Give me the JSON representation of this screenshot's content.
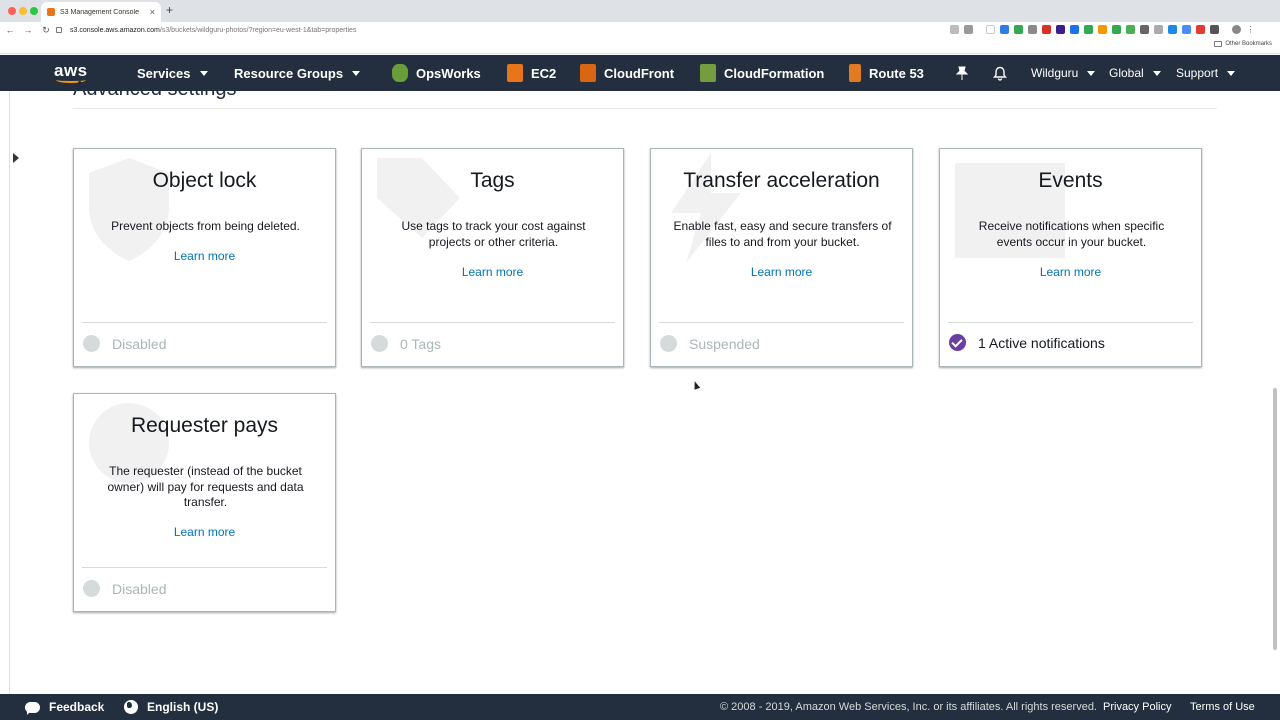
{
  "browser": {
    "tab_title": "S3 Management Console",
    "tab_close": "×",
    "new_tab": "+",
    "back": "←",
    "forward": "→",
    "reload": "↻",
    "url_host": "s3.console.aws.amazon.com",
    "url_path": "/s3/buckets/wildguru-photos/?region=eu-west-1&tab=properties",
    "other_bookmarks": "Other Bookmarks"
  },
  "nav": {
    "logo": "aws",
    "services": "Services",
    "resource_groups": "Resource Groups",
    "opsworks": "OpsWorks",
    "ec2": "EC2",
    "cloudfront": "CloudFront",
    "cloudformation": "CloudFormation",
    "route53": "Route 53",
    "account": "Wildguru",
    "region": "Global",
    "support": "Support"
  },
  "section": {
    "title": "Advanced settings"
  },
  "cards": [
    {
      "title": "Object lock",
      "description": "Prevent objects from being deleted.",
      "link": "Learn more",
      "status": "Disabled"
    },
    {
      "title": "Tags",
      "description": "Use tags to track your cost against projects or other criteria.",
      "link": "Learn more",
      "status": "0 Tags"
    },
    {
      "title": "Transfer acceleration",
      "description": "Enable fast, easy and secure transfers of files to and from your bucket.",
      "link": "Learn more",
      "status": "Suspended"
    },
    {
      "title": "Events",
      "description": "Receive notifications when specific events occur in your bucket.",
      "link": "Learn more",
      "status": "1 Active notifications"
    },
    {
      "title": "Requester pays",
      "description": "The requester (instead of the bucket owner) will pay for requests and data transfer.",
      "link": "Learn more",
      "status": "Disabled"
    }
  ],
  "footer": {
    "feedback": "Feedback",
    "language": "English (US)",
    "copyright": "© 2008 - 2019, Amazon Web Services, Inc. or its affiliates. All rights reserved.",
    "privacy": "Privacy Policy",
    "terms": "Terms of Use"
  },
  "colors": {
    "nav_bg": "#232f3e",
    "link": "#0073bb",
    "active_status": "#6b3fa0",
    "aws_orange": "#ff9900"
  }
}
